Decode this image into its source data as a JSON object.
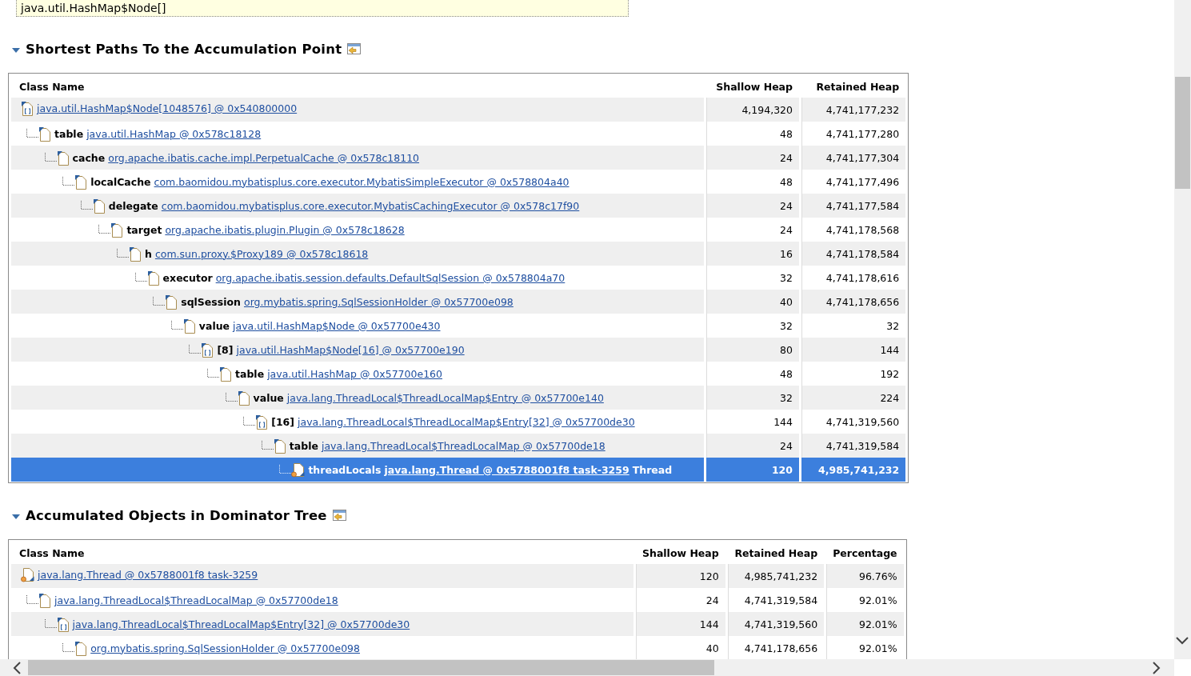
{
  "top_box": {
    "text": "java.util.HashMap$Node[]"
  },
  "sections": [
    {
      "title": "Shortest Paths To the Accumulation Point",
      "expanded": true,
      "name_column": "Class Name",
      "value_columns": [
        "Shallow Heap",
        "Retained Heap"
      ],
      "rows": [
        {
          "kind": "array",
          "link": "java.util.HashMap$Node[1048576] @ 0x540800000",
          "cells": [
            "4,194,320",
            "4,741,177,232"
          ],
          "selected": false,
          "children": [
            {
              "kind": "object",
              "field": "table",
              "link": "java.util.HashMap @ 0x578c18128",
              "cells": [
                "48",
                "4,741,177,280"
              ],
              "selected": false,
              "children": [
                {
                  "kind": "object",
                  "field": "cache",
                  "link": "org.apache.ibatis.cache.impl.PerpetualCache @ 0x578c18110",
                  "cells": [
                    "24",
                    "4,741,177,304"
                  ],
                  "selected": false,
                  "children": [
                    {
                      "kind": "object",
                      "field": "localCache",
                      "link": "com.baomidou.mybatisplus.core.executor.MybatisSimpleExecutor @ 0x578804a40",
                      "cells": [
                        "48",
                        "4,741,177,496"
                      ],
                      "selected": false,
                      "children": [
                        {
                          "kind": "object",
                          "field": "delegate",
                          "link": "com.baomidou.mybatisplus.core.executor.MybatisCachingExecutor @ 0x578c17f90",
                          "cells": [
                            "24",
                            "4,741,177,584"
                          ],
                          "selected": false,
                          "children": [
                            {
                              "kind": "object",
                              "field": "target",
                              "link": "org.apache.ibatis.plugin.Plugin @ 0x578c18628",
                              "cells": [
                                "24",
                                "4,741,178,568"
                              ],
                              "selected": false,
                              "children": [
                                {
                                  "kind": "object",
                                  "field": "h",
                                  "link": "com.sun.proxy.$Proxy189 @ 0x578c18618",
                                  "cells": [
                                    "16",
                                    "4,741,178,584"
                                  ],
                                  "selected": false,
                                  "children": [
                                    {
                                      "kind": "object",
                                      "field": "executor",
                                      "link": "org.apache.ibatis.session.defaults.DefaultSqlSession @ 0x578804a70",
                                      "cells": [
                                        "32",
                                        "4,741,178,616"
                                      ],
                                      "selected": false,
                                      "children": [
                                        {
                                          "kind": "object",
                                          "field": "sqlSession",
                                          "link": "org.mybatis.spring.SqlSessionHolder @ 0x57700e098",
                                          "cells": [
                                            "40",
                                            "4,741,178,656"
                                          ],
                                          "selected": false,
                                          "children": [
                                            {
                                              "kind": "object",
                                              "field": "value",
                                              "link": "java.util.HashMap$Node @ 0x57700e430",
                                              "cells": [
                                                "32",
                                                "32"
                                              ],
                                              "selected": false,
                                              "children": [
                                                {
                                                  "kind": "array",
                                                  "field": "[8]",
                                                  "link": "java.util.HashMap$Node[16] @ 0x57700e190",
                                                  "cells": [
                                                    "80",
                                                    "144"
                                                  ],
                                                  "selected": false,
                                                  "children": [
                                                    {
                                                      "kind": "object",
                                                      "field": "table",
                                                      "link": "java.util.HashMap @ 0x57700e160",
                                                      "cells": [
                                                        "48",
                                                        "192"
                                                      ],
                                                      "selected": false,
                                                      "children": [
                                                        {
                                                          "kind": "object",
                                                          "field": "value",
                                                          "link": "java.lang.ThreadLocal$ThreadLocalMap$Entry @ 0x57700e140",
                                                          "cells": [
                                                            "32",
                                                            "224"
                                                          ],
                                                          "selected": false,
                                                          "children": [
                                                            {
                                                              "kind": "array",
                                                              "field": "[16]",
                                                              "link": "java.lang.ThreadLocal$ThreadLocalMap$Entry[32] @ 0x57700de30",
                                                              "cells": [
                                                                "144",
                                                                "4,741,319,560"
                                                              ],
                                                              "selected": false,
                                                              "children": [
                                                                {
                                                                  "kind": "object",
                                                                  "field": "table",
                                                                  "link": "java.lang.ThreadLocal$ThreadLocalMap @ 0x57700de18",
                                                                  "cells": [
                                                                    "24",
                                                                    "4,741,319,584"
                                                                  ],
                                                                  "selected": false,
                                                                  "children": [
                                                                    {
                                                                      "kind": "thread",
                                                                      "field": "threadLocals",
                                                                      "link": "java.lang.Thread @ 0x5788001f8 task-3259",
                                                                      "suffix": "Thread",
                                                                      "cells": [
                                                                        "120",
                                                                        "4,985,741,232"
                                                                      ],
                                                                      "selected": true
                                                                    }
                                                                  ]
                                                                }
                                                              ]
                                                            }
                                                          ]
                                                        }
                                                      ]
                                                    }
                                                  ]
                                                }
                                              ]
                                            }
                                          ]
                                        }
                                      ]
                                    }
                                  ]
                                }
                              ]
                            }
                          ]
                        }
                      ]
                    }
                  ]
                }
              ]
            }
          ]
        }
      ]
    },
    {
      "title": "Accumulated Objects in Dominator Tree",
      "expanded": true,
      "name_column": "Class Name",
      "value_columns": [
        "Shallow Heap",
        "Retained Heap",
        "Percentage"
      ],
      "rows": [
        {
          "kind": "thread",
          "link": "java.lang.Thread @ 0x5788001f8 task-3259",
          "cells": [
            "120",
            "4,985,741,232",
            "96.76%"
          ],
          "selected": false,
          "children": [
            {
              "kind": "object",
              "link": "java.lang.ThreadLocal$ThreadLocalMap @ 0x57700de18",
              "cells": [
                "24",
                "4,741,319,584",
                "92.01%"
              ],
              "selected": false,
              "children": [
                {
                  "kind": "array",
                  "link": "java.lang.ThreadLocal$ThreadLocalMap$Entry[32] @ 0x57700de30",
                  "cells": [
                    "144",
                    "4,741,319,560",
                    "92.01%"
                  ],
                  "selected": false,
                  "children": [
                    {
                      "kind": "object",
                      "link": "org.mybatis.spring.SqlSessionHolder @ 0x57700e098",
                      "cells": [
                        "40",
                        "4,741,178,656",
                        "92.01%"
                      ],
                      "selected": false
                    }
                  ]
                }
              ]
            }
          ]
        }
      ]
    }
  ]
}
